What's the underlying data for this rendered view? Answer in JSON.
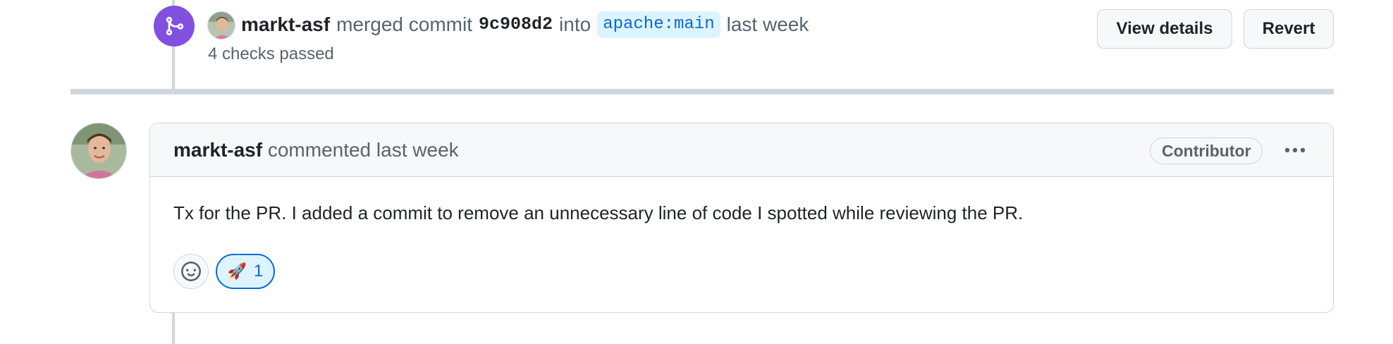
{
  "merge_event": {
    "author": "markt-asf",
    "action": "merged commit",
    "commit_sha": "9c908d2",
    "into_text": "into",
    "branch": "apache:main",
    "time": "last week",
    "checks": "4 checks passed",
    "view_details_label": "View details",
    "revert_label": "Revert",
    "icon": "git-merge-icon",
    "badge_color": "#8250df"
  },
  "comment": {
    "author": "markt-asf",
    "action": "commented",
    "time": "last week",
    "role_badge": "Contributor",
    "body": "Tx for the PR. I added a commit to remove an unnecessary line of code I spotted while reviewing the PR.",
    "menu_icon": "kebab-horizontal-icon",
    "add_reaction_icon": "smiley-icon",
    "reactions": [
      {
        "emoji": "🚀",
        "count": "1",
        "icon": "rocket-icon"
      }
    ]
  }
}
